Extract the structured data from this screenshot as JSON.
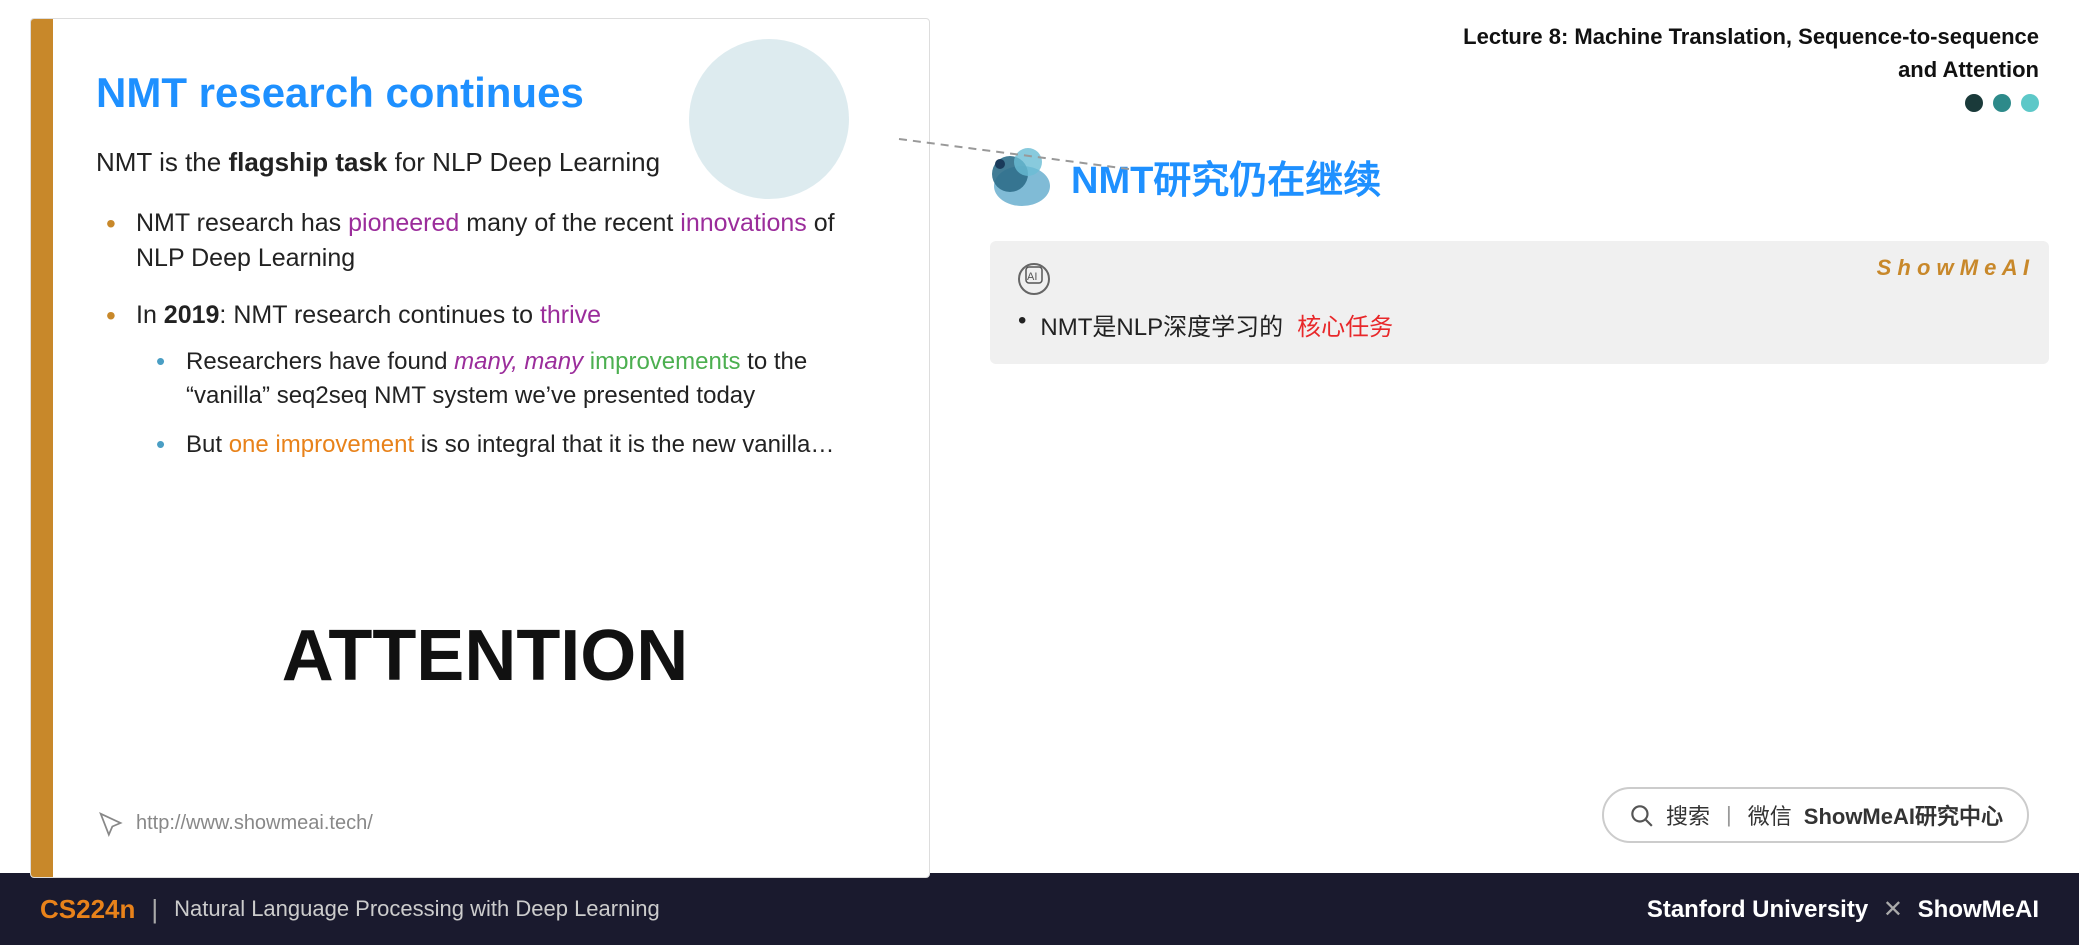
{
  "slide": {
    "title": "NMT research continues",
    "intro_normal": "NMT is the ",
    "intro_bold": "flagship task",
    "intro_suffix": " for NLP Deep Learning",
    "bullets": [
      {
        "text_before": "NMT research has ",
        "text_purple": "pioneered",
        "text_middle": " many of the recent ",
        "text_purple2": "innovations",
        "text_after": " of NLP Deep Learning",
        "sub_bullets": []
      },
      {
        "text_before": "In ",
        "text_bold": "2019",
        "text_middle": ": NMT research continues to ",
        "text_purple": "thrive",
        "text_after": "",
        "sub_bullets": [
          {
            "text_before": "Researchers have found ",
            "text_italic_purple": "many, many",
            "text_green": " improvements",
            "text_after": " to the “vanilla” seq2seq NMT system we’ve presented today"
          },
          {
            "text_before": "But ",
            "text_orange": "one improvement",
            "text_after": " is so integral that it is the new vanilla…"
          }
        ]
      }
    ],
    "attention": "ATTENTION",
    "url": "http://www.showmeai.tech/"
  },
  "right_panel": {
    "lecture_title_line1": "Lecture 8:  Machine Translation, Sequence-to-sequence",
    "lecture_title_line2": "and Attention",
    "cn_title": "NMT研究仍在继续",
    "showmeai_brand": "S h o w M e A I",
    "showmeai_bullet": "NMT是NLP深度学习的",
    "showmeai_bullet_red": "核心任务"
  },
  "search": {
    "icon_label": "search-icon",
    "divider": "|",
    "text": "搜索 | 微信 ShowMeAI研究中心"
  },
  "bottom_bar": {
    "cs224n": "CS224n",
    "divider": "|",
    "subtitle": "Natural Language Processing with Deep Learning",
    "right": "Stanford University",
    "right_x": "✕",
    "right_brand": "ShowMeAI"
  }
}
